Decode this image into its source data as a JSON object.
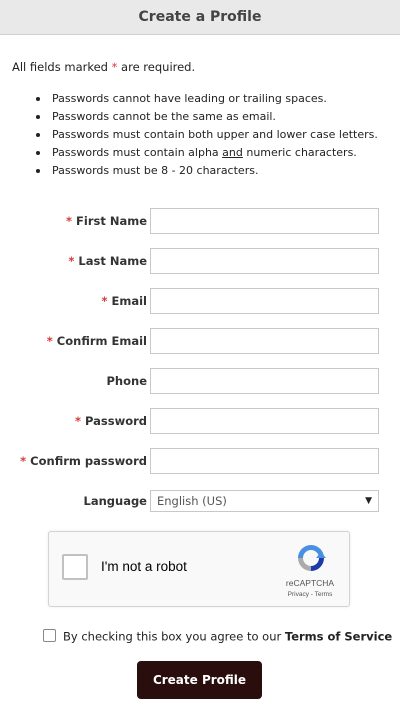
{
  "header": {
    "title": "Create a Profile"
  },
  "required_note": {
    "before": "All fields marked ",
    "star": "*",
    "after": " are required."
  },
  "password_rules": [
    "Passwords cannot have leading or trailing spaces.",
    "Passwords cannot be the same as email.",
    "Passwords must contain both upper and lower case letters.",
    {
      "before": "Passwords must contain alpha ",
      "underlined": "and",
      "after": " numeric characters."
    },
    "Passwords must be 8 - 20 characters."
  ],
  "form": {
    "required_star": "*",
    "first_name": {
      "label": "First Name",
      "value": ""
    },
    "last_name": {
      "label": "Last Name",
      "value": ""
    },
    "email": {
      "label": "Email",
      "value": ""
    },
    "confirm_email": {
      "label": "Confirm Email",
      "value": ""
    },
    "phone": {
      "label": "Phone",
      "value": ""
    },
    "password": {
      "label": "Password",
      "value": ""
    },
    "confirm_password": {
      "label": "Confirm password",
      "value": ""
    },
    "language": {
      "label": "Language",
      "selected": "English (US)"
    }
  },
  "captcha": {
    "label": "I'm not a robot",
    "brand": "reCAPTCHA",
    "links": "Privacy - Terms",
    "checked": false
  },
  "terms": {
    "text": "By checking this box you agree to our ",
    "link": "Terms of Service",
    "checked": false
  },
  "submit": {
    "label": "Create Profile"
  },
  "colors": {
    "required_star": "#d53a3a",
    "header_bg": "#e9e9e9",
    "submit_bg": "#2a0d0d"
  }
}
